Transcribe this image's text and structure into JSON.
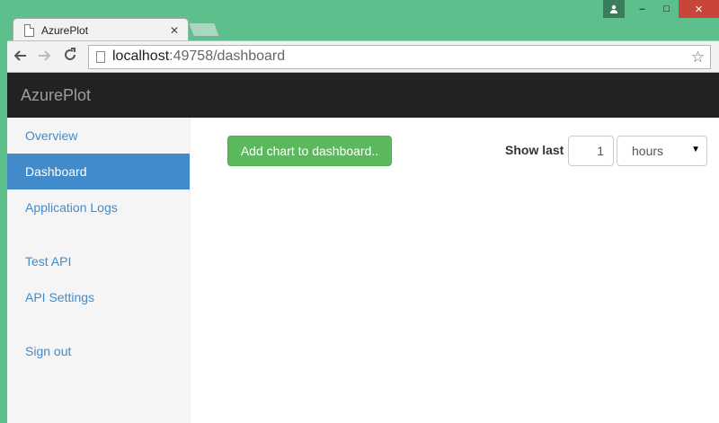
{
  "browser": {
    "tab_title": "AzurePlot",
    "tab_close": "✕",
    "url_host": "localhost",
    "url_rest": ":49758/dashboard",
    "win_minimize": "–",
    "win_maximize": "□",
    "win_close": "✕"
  },
  "app": {
    "brand": "AzurePlot"
  },
  "sidebar": {
    "items": [
      {
        "label": "Overview"
      },
      {
        "label": "Dashboard"
      },
      {
        "label": "Application Logs"
      },
      {
        "label": "Test API"
      },
      {
        "label": "API Settings"
      },
      {
        "label": "Sign out"
      }
    ]
  },
  "main": {
    "add_chart_label": "Add chart to dashboard..",
    "show_last_label": "Show last",
    "show_last_value": "1",
    "unit_selected": "hours"
  },
  "colors": {
    "frame": "#5cbf8c",
    "navbar": "#222222",
    "accent": "#428bca",
    "success": "#5cb85c"
  }
}
